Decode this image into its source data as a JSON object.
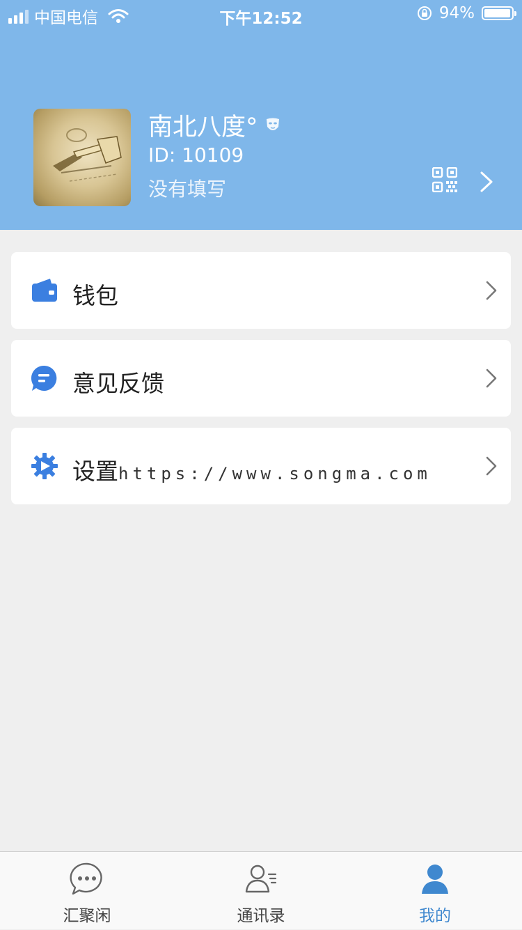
{
  "status_bar": {
    "carrier": "中国电信",
    "time": "下午12:52",
    "battery_percent": "94%",
    "battery_level": 0.94,
    "text_color": "#ffffff"
  },
  "profile": {
    "name": "南北八度°",
    "id_text": "ID: 10109",
    "description": "没有填写",
    "header_color": "#7fb7ea"
  },
  "menu": [
    {
      "label": "钱包",
      "icon": "wallet-icon"
    },
    {
      "label": "意见反馈",
      "icon": "feedback-icon"
    },
    {
      "label": "设置",
      "icon": "settings-gear-icon"
    }
  ],
  "watermark": "https://www.songma.com",
  "tabs": [
    {
      "label": "汇聚闲",
      "icon": "chat-bubble-icon",
      "active": false
    },
    {
      "label": "通讯录",
      "icon": "contacts-icon",
      "active": false
    },
    {
      "label": "我的",
      "icon": "person-icon",
      "active": true
    }
  ],
  "colors": {
    "accent": "#3f88cf",
    "icon_blue": "#3b7fe0",
    "background": "#efefef"
  }
}
